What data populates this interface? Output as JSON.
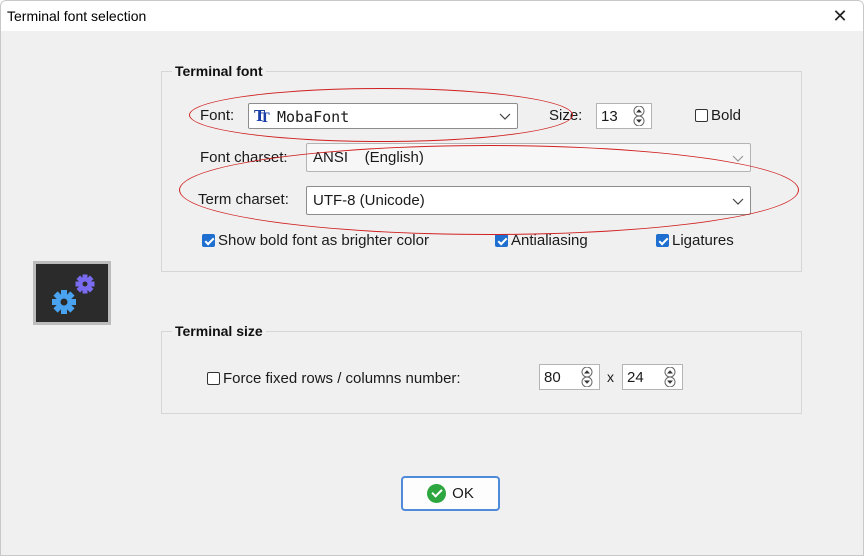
{
  "window": {
    "title": "Terminal font selection",
    "close_glyph": "✕"
  },
  "terminal_font": {
    "legend": "Terminal font",
    "font_label": "Font:",
    "font_value": "MobaFont",
    "font_icon": "truetype-font-icon",
    "size_label": "Size:",
    "size_value": "13",
    "bold_label": "Bold",
    "bold_checked": false,
    "charset_label": "Font charset:",
    "charset_value": "ANSI    (English)",
    "term_charset_label": "Term charset:",
    "term_charset_value": "UTF-8 (Unicode)",
    "bold_bright_label": "Show bold font as brighter color",
    "bold_bright_checked": true,
    "antialias_label": "Antialiasing",
    "antialias_checked": true,
    "ligatures_label": "Ligatures",
    "ligatures_checked": true
  },
  "terminal_size": {
    "legend": "Terminal size",
    "force_label": "Force fixed rows / columns number:",
    "force_checked": false,
    "columns_value": "80",
    "times_label": "x",
    "rows_value": "24"
  },
  "ok_button": {
    "label": "OK"
  },
  "colors": {
    "accent": "#1f6fd1",
    "annotation": "#d02020",
    "ok_green": "#2ea640",
    "gear_blue": "#4aa3f0",
    "gear_purple": "#7a6cf0"
  }
}
